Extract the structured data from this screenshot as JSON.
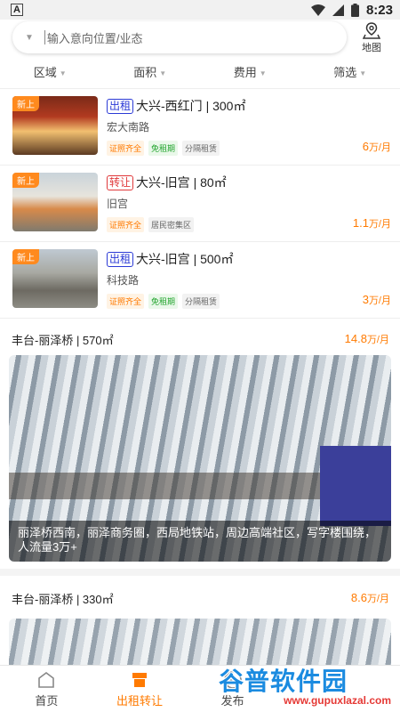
{
  "status": {
    "time": "8:23",
    "battery": "8",
    "notif_icon": "A"
  },
  "search": {
    "placeholder": "输入意向位置/业态",
    "map_label": "地图"
  },
  "filters": [
    "区域",
    "面积",
    "费用",
    "筛选"
  ],
  "listings": [
    {
      "badge": "出租",
      "badge_color": "blue",
      "title": "大兴-西红门 | 300㎡",
      "address": "宏大南路",
      "tags": [
        "证照齐全",
        "免租期",
        "分隔租赁"
      ],
      "price_num": "6",
      "price_unit": "万/月",
      "new_tag": "新上"
    },
    {
      "badge": "转让",
      "badge_color": "red",
      "title": "大兴-旧宫 | 80㎡",
      "address": "旧宫",
      "tags": [
        "证照齐全",
        "居民密集区"
      ],
      "price_num": "1.1",
      "price_unit": "万/月",
      "new_tag": "新上"
    },
    {
      "badge": "出租",
      "badge_color": "blue",
      "title": "大兴-旧宫 | 500㎡",
      "address": "科技路",
      "tags": [
        "证照齐全",
        "免租期",
        "分隔租赁"
      ],
      "price_num": "3",
      "price_unit": "万/月",
      "new_tag": "新上"
    }
  ],
  "featured": [
    {
      "title": "丰台-丽泽桥 | 570㎡",
      "price_num": "14.8",
      "price_unit": "万/月",
      "caption": "丽泽桥西南，丽泽商务圈，西局地铁站，周边高端社区，写字楼围绕，人流量3万+"
    },
    {
      "title": "丰台-丽泽桥 | 330㎡",
      "price_num": "8.6",
      "price_unit": "万/月"
    }
  ],
  "tabs": [
    {
      "label": "首页",
      "icon": "home-icon",
      "active": false
    },
    {
      "label": "出租转让",
      "icon": "shop-icon",
      "active": true
    },
    {
      "label": "发布",
      "icon": "add-icon",
      "active": false
    }
  ],
  "watermark": {
    "text": "谷普软件园",
    "url": "www.gupuxlazal.com"
  },
  "colors": {
    "accent": "#ff7a00",
    "blue_badge": "#2b3ad6",
    "red_badge": "#e0383a"
  }
}
